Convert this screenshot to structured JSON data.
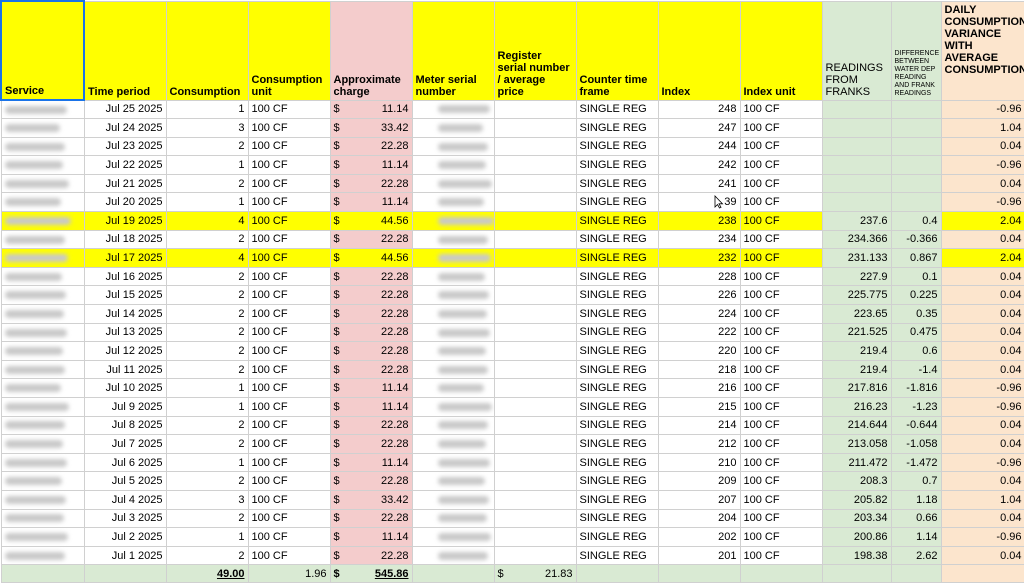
{
  "headers": {
    "service": "Service",
    "time_period": "Time period",
    "consumption": "Consumption",
    "consumption_unit": "Consumption unit",
    "approx_charge": "Approximate charge",
    "meter_serial": "Meter serial number",
    "register_serial": "Register serial number / average price",
    "counter_time_frame": "Counter time frame",
    "index": "Index",
    "index_unit": "Index unit",
    "readings_from_franks": "READINGS FROM FRANKS",
    "difference": "DIFFERENCE BETWEEN WATER DEP READING AND FRANK READINGS",
    "daily_variance": "DAILY CONSUMPTION VARIANCE WITH AVERAGE CONSUMPTION"
  },
  "rows": [
    {
      "date": "Jul 25 2025",
      "consumption": "1",
      "unit": "100 CF",
      "currency": "$",
      "charge": "11.14",
      "frame": "SINGLE REG",
      "index": "248",
      "index_unit": "100 CF",
      "reading": "",
      "diff": "",
      "variance": "-0.96",
      "highlight": false
    },
    {
      "date": "Jul 24 2025",
      "consumption": "3",
      "unit": "100 CF",
      "currency": "$",
      "charge": "33.42",
      "frame": "SINGLE REG",
      "index": "247",
      "index_unit": "100 CF",
      "reading": "",
      "diff": "",
      "variance": "1.04",
      "highlight": false
    },
    {
      "date": "Jul 23 2025",
      "consumption": "2",
      "unit": "100 CF",
      "currency": "$",
      "charge": "22.28",
      "frame": "SINGLE REG",
      "index": "244",
      "index_unit": "100 CF",
      "reading": "",
      "diff": "",
      "variance": "0.04",
      "highlight": false
    },
    {
      "date": "Jul 22 2025",
      "consumption": "1",
      "unit": "100 CF",
      "currency": "$",
      "charge": "11.14",
      "frame": "SINGLE REG",
      "index": "242",
      "index_unit": "100 CF",
      "reading": "",
      "diff": "",
      "variance": "-0.96",
      "highlight": false
    },
    {
      "date": "Jul 21 2025",
      "consumption": "2",
      "unit": "100 CF",
      "currency": "$",
      "charge": "22.28",
      "frame": "SINGLE REG",
      "index": "241",
      "index_unit": "100 CF",
      "reading": "",
      "diff": "",
      "variance": "0.04",
      "highlight": false
    },
    {
      "date": "Jul 20 2025",
      "consumption": "1",
      "unit": "100 CF",
      "currency": "$",
      "charge": "11.14",
      "frame": "SINGLE REG",
      "index": "39",
      "index_unit": "100 CF",
      "reading": "",
      "diff": "",
      "variance": "-0.96",
      "highlight": false
    },
    {
      "date": "Jul 19 2025",
      "consumption": "4",
      "unit": "100 CF",
      "currency": "$",
      "charge": "44.56",
      "frame": "SINGLE REG",
      "index": "238",
      "index_unit": "100 CF",
      "reading": "237.6",
      "diff": "0.4",
      "variance": "2.04",
      "highlight": true
    },
    {
      "date": "Jul 18 2025",
      "consumption": "2",
      "unit": "100 CF",
      "currency": "$",
      "charge": "22.28",
      "frame": "SINGLE REG",
      "index": "234",
      "index_unit": "100 CF",
      "reading": "234.366",
      "diff": "-0.366",
      "variance": "0.04",
      "highlight": false
    },
    {
      "date": "Jul 17 2025",
      "consumption": "4",
      "unit": "100 CF",
      "currency": "$",
      "charge": "44.56",
      "frame": "SINGLE REG",
      "index": "232",
      "index_unit": "100 CF",
      "reading": "231.133",
      "diff": "0.867",
      "variance": "2.04",
      "highlight": true
    },
    {
      "date": "Jul 16 2025",
      "consumption": "2",
      "unit": "100 CF",
      "currency": "$",
      "charge": "22.28",
      "frame": "SINGLE REG",
      "index": "228",
      "index_unit": "100 CF",
      "reading": "227.9",
      "diff": "0.1",
      "variance": "0.04",
      "highlight": false
    },
    {
      "date": "Jul 15 2025",
      "consumption": "2",
      "unit": "100 CF",
      "currency": "$",
      "charge": "22.28",
      "frame": "SINGLE REG",
      "index": "226",
      "index_unit": "100 CF",
      "reading": "225.775",
      "diff": "0.225",
      "variance": "0.04",
      "highlight": false
    },
    {
      "date": "Jul 14 2025",
      "consumption": "2",
      "unit": "100 CF",
      "currency": "$",
      "charge": "22.28",
      "frame": "SINGLE REG",
      "index": "224",
      "index_unit": "100 CF",
      "reading": "223.65",
      "diff": "0.35",
      "variance": "0.04",
      "highlight": false
    },
    {
      "date": "Jul 13 2025",
      "consumption": "2",
      "unit": "100 CF",
      "currency": "$",
      "charge": "22.28",
      "frame": "SINGLE REG",
      "index": "222",
      "index_unit": "100 CF",
      "reading": "221.525",
      "diff": "0.475",
      "variance": "0.04",
      "highlight": false
    },
    {
      "date": "Jul 12 2025",
      "consumption": "2",
      "unit": "100 CF",
      "currency": "$",
      "charge": "22.28",
      "frame": "SINGLE REG",
      "index": "220",
      "index_unit": "100 CF",
      "reading": "219.4",
      "diff": "0.6",
      "variance": "0.04",
      "highlight": false
    },
    {
      "date": "Jul 11 2025",
      "consumption": "2",
      "unit": "100 CF",
      "currency": "$",
      "charge": "22.28",
      "frame": "SINGLE REG",
      "index": "218",
      "index_unit": "100 CF",
      "reading": "219.4",
      "diff": "-1.4",
      "variance": "0.04",
      "highlight": false
    },
    {
      "date": "Jul 10 2025",
      "consumption": "1",
      "unit": "100 CF",
      "currency": "$",
      "charge": "11.14",
      "frame": "SINGLE REG",
      "index": "216",
      "index_unit": "100 CF",
      "reading": "217.816",
      "diff": "-1.816",
      "variance": "-0.96",
      "highlight": false
    },
    {
      "date": "Jul 9 2025",
      "consumption": "1",
      "unit": "100 CF",
      "currency": "$",
      "charge": "11.14",
      "frame": "SINGLE REG",
      "index": "215",
      "index_unit": "100 CF",
      "reading": "216.23",
      "diff": "-1.23",
      "variance": "-0.96",
      "highlight": false
    },
    {
      "date": "Jul 8 2025",
      "consumption": "2",
      "unit": "100 CF",
      "currency": "$",
      "charge": "22.28",
      "frame": "SINGLE REG",
      "index": "214",
      "index_unit": "100 CF",
      "reading": "214.644",
      "diff": "-0.644",
      "variance": "0.04",
      "highlight": false
    },
    {
      "date": "Jul 7 2025",
      "consumption": "2",
      "unit": "100 CF",
      "currency": "$",
      "charge": "22.28",
      "frame": "SINGLE REG",
      "index": "212",
      "index_unit": "100 CF",
      "reading": "213.058",
      "diff": "-1.058",
      "variance": "0.04",
      "highlight": false
    },
    {
      "date": "Jul 6 2025",
      "consumption": "1",
      "unit": "100 CF",
      "currency": "$",
      "charge": "11.14",
      "frame": "SINGLE REG",
      "index": "210",
      "index_unit": "100 CF",
      "reading": "211.472",
      "diff": "-1.472",
      "variance": "-0.96",
      "highlight": false
    },
    {
      "date": "Jul 5 2025",
      "consumption": "2",
      "unit": "100 CF",
      "currency": "$",
      "charge": "22.28",
      "frame": "SINGLE REG",
      "index": "209",
      "index_unit": "100 CF",
      "reading": "208.3",
      "diff": "0.7",
      "variance": "0.04",
      "highlight": false
    },
    {
      "date": "Jul 4 2025",
      "consumption": "3",
      "unit": "100 CF",
      "currency": "$",
      "charge": "33.42",
      "frame": "SINGLE REG",
      "index": "207",
      "index_unit": "100 CF",
      "reading": "205.82",
      "diff": "1.18",
      "variance": "1.04",
      "highlight": false
    },
    {
      "date": "Jul 3 2025",
      "consumption": "2",
      "unit": "100 CF",
      "currency": "$",
      "charge": "22.28",
      "frame": "SINGLE REG",
      "index": "204",
      "index_unit": "100 CF",
      "reading": "203.34",
      "diff": "0.66",
      "variance": "0.04",
      "highlight": false
    },
    {
      "date": "Jul 2 2025",
      "consumption": "1",
      "unit": "100 CF",
      "currency": "$",
      "charge": "11.14",
      "frame": "SINGLE REG",
      "index": "202",
      "index_unit": "100 CF",
      "reading": "200.86",
      "diff": "1.14",
      "variance": "-0.96",
      "highlight": false
    },
    {
      "date": "Jul 1 2025",
      "consumption": "2",
      "unit": "100 CF",
      "currency": "$",
      "charge": "22.28",
      "frame": "SINGLE REG",
      "index": "201",
      "index_unit": "100 CF",
      "reading": "198.38",
      "diff": "2.62",
      "variance": "0.04",
      "highlight": false
    }
  ],
  "totals": {
    "consumption": "49.00",
    "unit_avg": "1.96",
    "currency": "$",
    "charge": "545.86",
    "avg_price_currency": "$",
    "avg_price": "21.83"
  },
  "colors": {
    "header_yellow": "#ffff00",
    "charge_pink": "#f4cccc",
    "readings_green": "#d9ead3",
    "variance_orange": "#fce5cd",
    "selection_blue": "#1a73e8"
  }
}
